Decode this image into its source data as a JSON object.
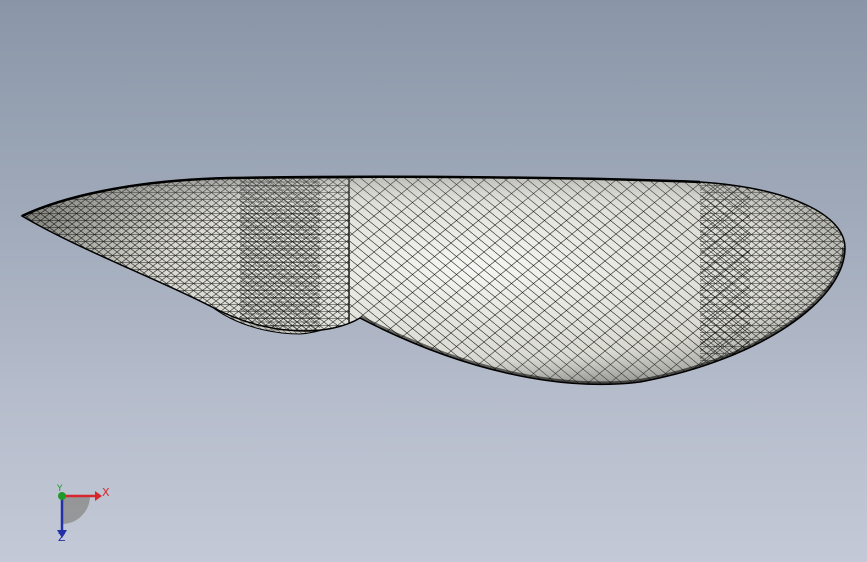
{
  "viewport": {
    "background_top": "#8a96a8",
    "background_bottom": "#c3c9d6"
  },
  "model": {
    "icon": "mesh-hull-model",
    "shade_color": "#f2f2ee",
    "mesh_color": "#000000"
  },
  "triad": {
    "x_label": "X",
    "y_label": "Y",
    "z_label": "Z",
    "x_color": "#d8262e",
    "y_color": "#1f9a2a",
    "z_color": "#2230a8"
  }
}
